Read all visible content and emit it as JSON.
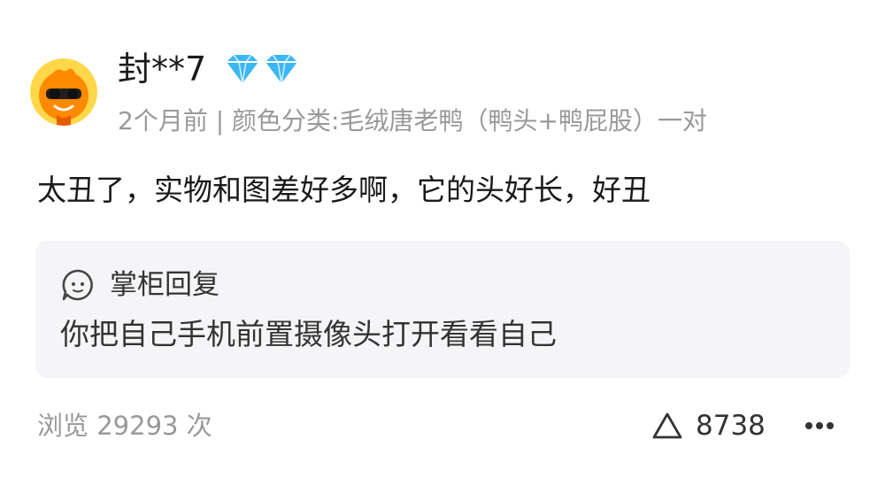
{
  "review": {
    "username": "封**7",
    "member_badge_icon": "diamond-icon",
    "meta": "2个月前 | 颜色分类:毛绒唐老鸭（鸭头+鸭屁股）一对",
    "text": "太丑了，实物和图差好多啊，它的头好长，好丑",
    "reply": {
      "icon": "smile-chat-icon",
      "title": "掌柜回复",
      "text": "你把自己手机前置摄像头打开看看自己"
    },
    "views": "浏览 29293 次",
    "likes": "8738",
    "like_icon": "triangle-like-icon",
    "more_icon": "more-dots-icon"
  },
  "colors": {
    "text_primary": "#1a1a1a",
    "text_secondary": "#999999",
    "reply_background": "#f5f5f7",
    "badge": "#3bb7f5",
    "avatar_bg": "#ff8a00"
  }
}
